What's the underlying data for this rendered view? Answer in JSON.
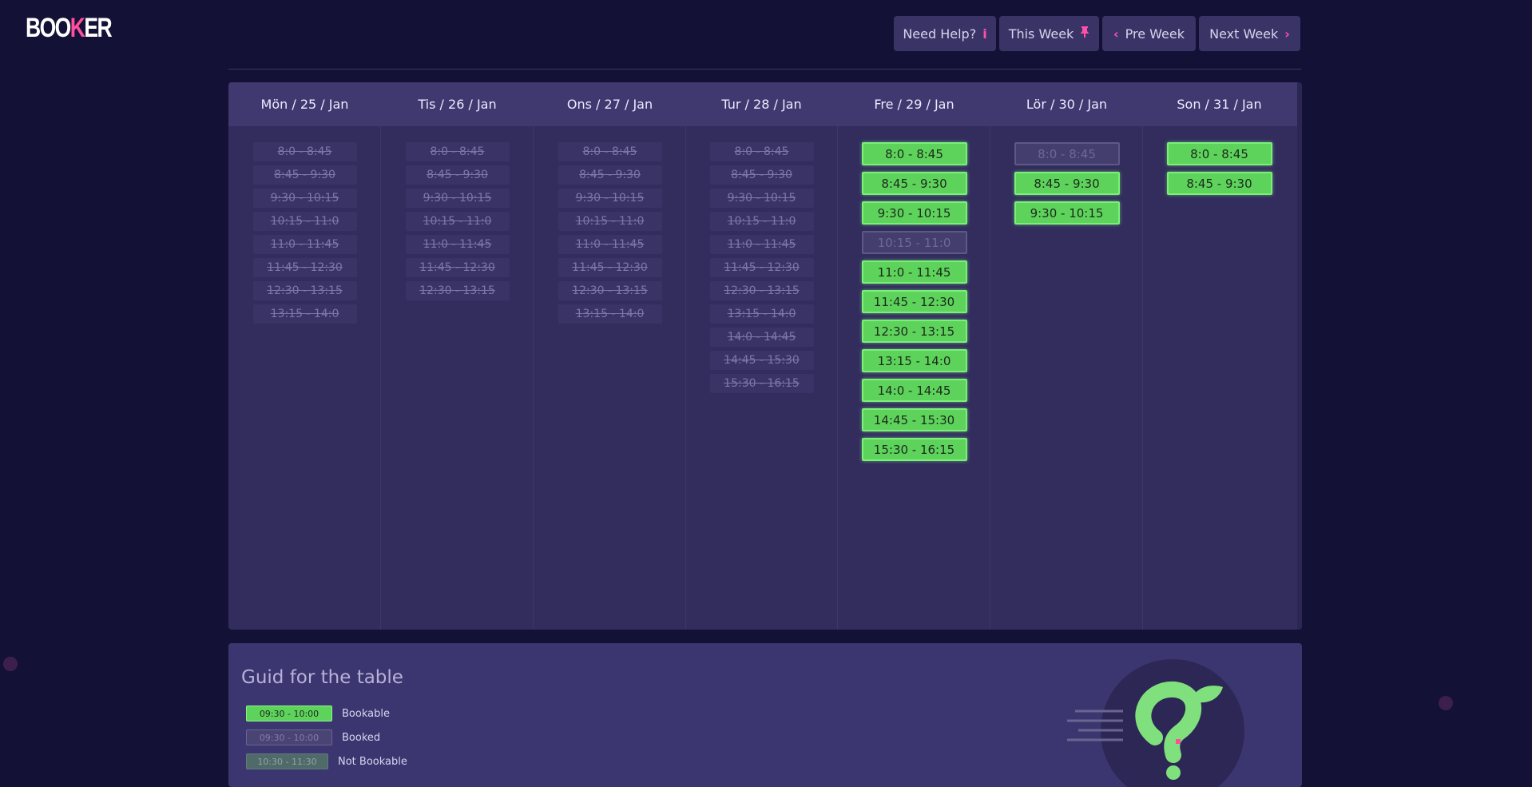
{
  "brand": {
    "logo_pre": "BOO",
    "logo_hl": "K",
    "logo_post": "ER"
  },
  "toolbar": {
    "help_label": "Need Help?",
    "this_week_label": "This Week",
    "pre_week_label": "Pre Week",
    "next_week_label": "Next Week"
  },
  "days": [
    {
      "label": "Mön / 25 / Jan"
    },
    {
      "label": "Tis / 26 / Jan"
    },
    {
      "label": "Ons / 27 / Jan"
    },
    {
      "label": "Tur / 28 / Jan"
    },
    {
      "label": "Fre / 29 / Jan"
    },
    {
      "label": "Lör / 30 / Jan"
    },
    {
      "label": "Son / 31 / Jan"
    }
  ],
  "slots": [
    [
      {
        "t": "8:0 - 8:45",
        "s": "na"
      },
      {
        "t": "8:45 - 9:30",
        "s": "na"
      },
      {
        "t": "9:30 - 10:15",
        "s": "na"
      },
      {
        "t": "10:15 - 11:0",
        "s": "na"
      },
      {
        "t": "11:0 - 11:45",
        "s": "na"
      },
      {
        "t": "11:45 - 12:30",
        "s": "na"
      },
      {
        "t": "12:30 - 13:15",
        "s": "na"
      },
      {
        "t": "13:15 - 14:0",
        "s": "na"
      }
    ],
    [
      {
        "t": "8:0 - 8:45",
        "s": "na"
      },
      {
        "t": "8:45 - 9:30",
        "s": "na"
      },
      {
        "t": "9:30 - 10:15",
        "s": "na"
      },
      {
        "t": "10:15 - 11:0",
        "s": "na"
      },
      {
        "t": "11:0 - 11:45",
        "s": "na"
      },
      {
        "t": "11:45 - 12:30",
        "s": "na"
      },
      {
        "t": "12:30 - 13:15",
        "s": "na"
      }
    ],
    [
      {
        "t": "8:0 - 8:45",
        "s": "na"
      },
      {
        "t": "8:45 - 9:30",
        "s": "na"
      },
      {
        "t": "9:30 - 10:15",
        "s": "na"
      },
      {
        "t": "10:15 - 11:0",
        "s": "na"
      },
      {
        "t": "11:0 - 11:45",
        "s": "na"
      },
      {
        "t": "11:45 - 12:30",
        "s": "na"
      },
      {
        "t": "12:30 - 13:15",
        "s": "na"
      },
      {
        "t": "13:15 - 14:0",
        "s": "na"
      }
    ],
    [
      {
        "t": "8:0 - 8:45",
        "s": "na"
      },
      {
        "t": "8:45 - 9:30",
        "s": "na"
      },
      {
        "t": "9:30 - 10:15",
        "s": "na"
      },
      {
        "t": "10:15 - 11:0",
        "s": "na"
      },
      {
        "t": "11:0 - 11:45",
        "s": "na"
      },
      {
        "t": "11:45 - 12:30",
        "s": "na"
      },
      {
        "t": "12:30 - 13:15",
        "s": "na"
      },
      {
        "t": "13:15 - 14:0",
        "s": "na"
      },
      {
        "t": "14:0 - 14:45",
        "s": "na"
      },
      {
        "t": "14:45 - 15:30",
        "s": "na"
      },
      {
        "t": "15:30 - 16:15",
        "s": "na"
      }
    ],
    [
      {
        "t": "8:0 - 8:45",
        "s": "ok"
      },
      {
        "t": "8:45 - 9:30",
        "s": "ok"
      },
      {
        "t": "9:30 - 10:15",
        "s": "ok"
      },
      {
        "t": "10:15 - 11:0",
        "s": "bk"
      },
      {
        "t": "11:0 - 11:45",
        "s": "ok"
      },
      {
        "t": "11:45 - 12:30",
        "s": "ok"
      },
      {
        "t": "12:30 - 13:15",
        "s": "ok"
      },
      {
        "t": "13:15 - 14:0",
        "s": "ok"
      },
      {
        "t": "14:0 - 14:45",
        "s": "ok"
      },
      {
        "t": "14:45 - 15:30",
        "s": "ok"
      },
      {
        "t": "15:30 - 16:15",
        "s": "ok"
      }
    ],
    [
      {
        "t": "8:0 - 8:45",
        "s": "bk"
      },
      {
        "t": "8:45 - 9:30",
        "s": "ok"
      },
      {
        "t": "9:30 - 10:15",
        "s": "ok"
      }
    ],
    [
      {
        "t": "8:0 - 8:45",
        "s": "ok"
      },
      {
        "t": "8:45 - 9:30",
        "s": "ok"
      }
    ]
  ],
  "guide": {
    "title": "Guid for the table",
    "items": [
      {
        "sample": "09:30 - 10:00",
        "label": "Bookable",
        "kind": "ok"
      },
      {
        "sample": "09:30 - 10:00",
        "label": "Booked",
        "kind": "bk"
      },
      {
        "sample": "10:30 - 11:30",
        "label": "Not Bookable",
        "kind": "na"
      }
    ]
  },
  "colors": {
    "background": "#141136",
    "panel": "#332d5e",
    "bookable": "#5ed35c",
    "accent": "#ff4fa8"
  }
}
